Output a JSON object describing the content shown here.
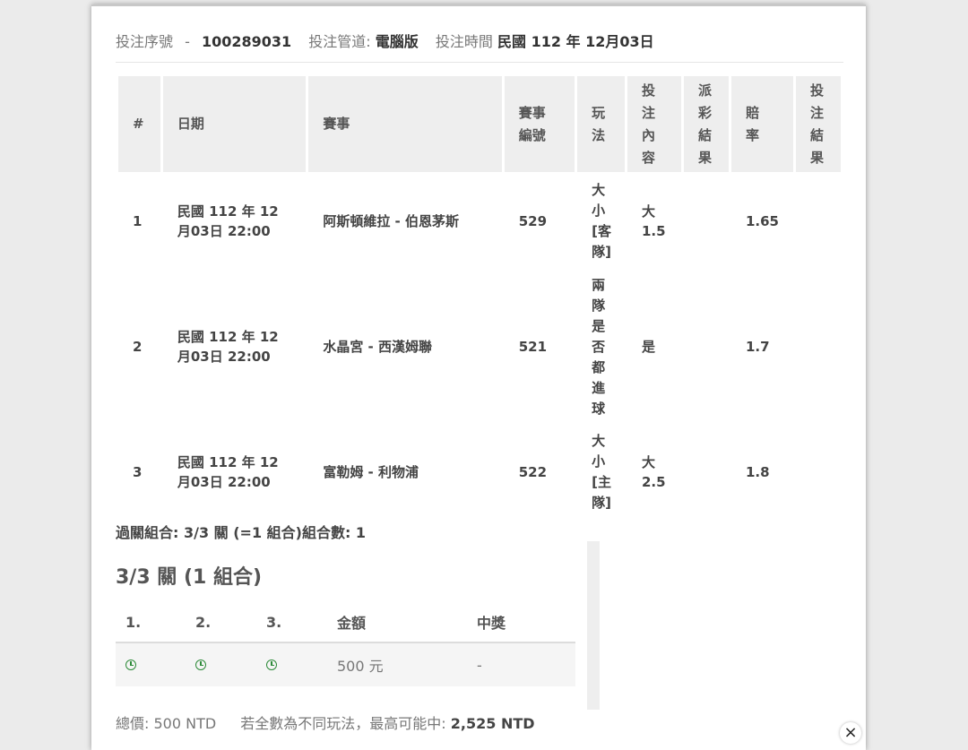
{
  "info": {
    "serial_label": "投注序號",
    "serial_sep": "-",
    "serial_value": "100289031",
    "channel_label": "投注管道:",
    "channel_value": "電腦版",
    "time_label": "投注時間",
    "time_value": "民國 112 年 12月03日"
  },
  "table": {
    "headers": {
      "num": "#",
      "date": "日期",
      "event": "賽事",
      "event_no": "賽事編號",
      "play": "玩法",
      "content": "投注內容",
      "payout": "派彩結果",
      "odds": "賠率",
      "result": "投注結果"
    },
    "rows": [
      {
        "num": "1",
        "date": "民國 112 年 12月03日 22:00",
        "event": "阿斯頓維拉 - 伯恩茅斯",
        "event_no": "529",
        "play": "大小[客隊]",
        "content": "大 1.5",
        "odds": "1.65"
      },
      {
        "num": "2",
        "date": "民國 112 年 12月03日 22:00",
        "event": "水晶宮 - 西漢姆聯",
        "event_no": "521",
        "play": "兩隊是否都進球",
        "content": "是",
        "odds": "1.7"
      },
      {
        "num": "3",
        "date": "民國 112 年 12月03日 22:00",
        "event": "富勒姆 - 利物浦",
        "event_no": "522",
        "play": "大小[主隊]",
        "content": "大 2.5",
        "odds": "1.8"
      }
    ]
  },
  "combo": {
    "summary": "過關組合: 3/3 關 (=1 組合)組合數: 1",
    "title": "3/3 關 (1 組合)",
    "headers": [
      "1.",
      "2.",
      "3.",
      "金額",
      "中獎"
    ],
    "row": {
      "amount": "500 元",
      "win": "-"
    }
  },
  "total": {
    "label": "總價:",
    "value": "500 NTD",
    "max_label": "若全數為不同玩法，最高可能中:",
    "max_value": "2,525 NTD"
  },
  "icons": {
    "clock": "clock-icon",
    "close": "close-icon"
  },
  "colors": {
    "clock_green": "#2e8b3a",
    "header_bg": "#eeeeee"
  },
  "close_glyph": "×"
}
